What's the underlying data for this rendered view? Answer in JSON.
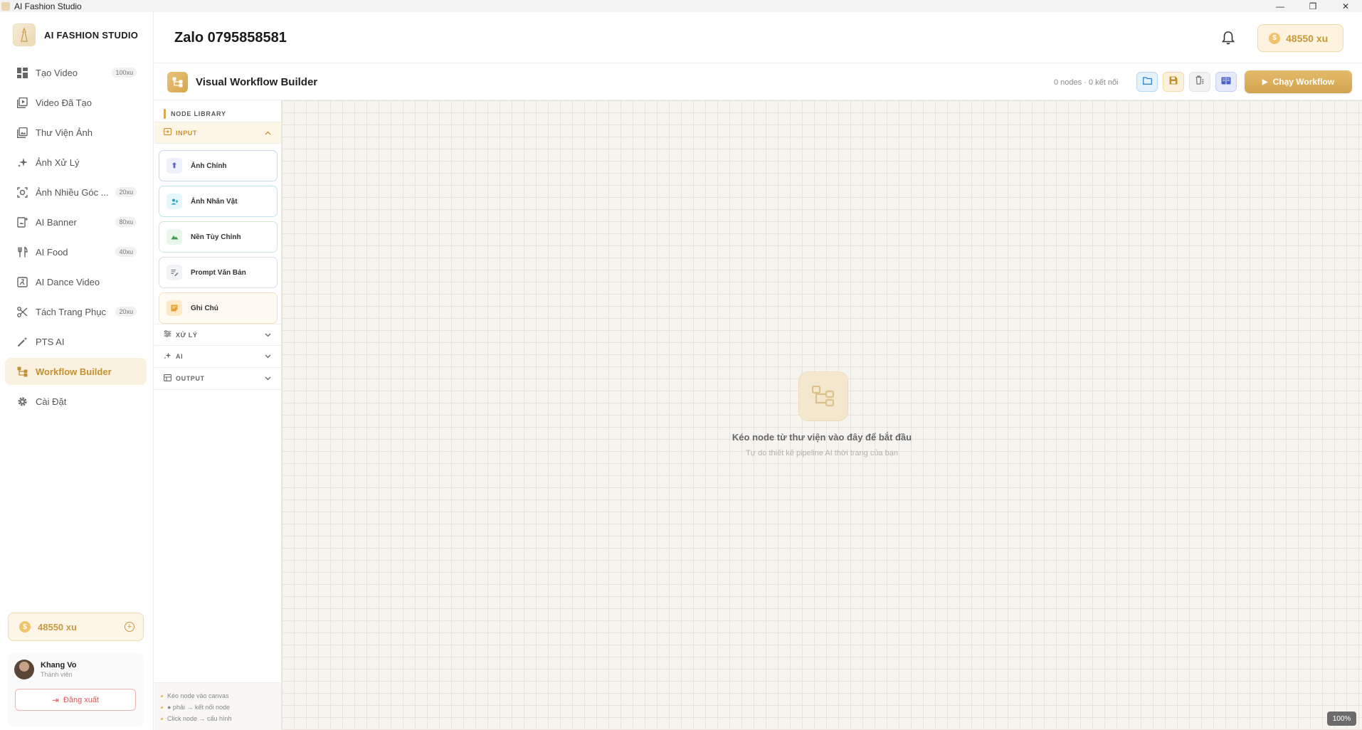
{
  "window": {
    "title": "AI Fashion Studio",
    "controls": [
      "—",
      "❐",
      "✕"
    ]
  },
  "brand": {
    "name": "AI FASHION STUDIO"
  },
  "sidebar": {
    "items": [
      {
        "label": "Tạo Video",
        "badge": "100xu",
        "icon": "grid-icon"
      },
      {
        "label": "Video Đã Tạo",
        "badge": "",
        "icon": "video-library-icon"
      },
      {
        "label": "Thư Viện Ảnh",
        "badge": "",
        "icon": "image-library-icon"
      },
      {
        "label": "Ảnh Xử Lý",
        "badge": "",
        "icon": "sparkle-icon"
      },
      {
        "label": "Ảnh Nhiều Góc ...",
        "badge": "20xu",
        "icon": "camera-icon"
      },
      {
        "label": "AI Banner",
        "badge": "80xu",
        "icon": "banner-icon"
      },
      {
        "label": "AI Food",
        "badge": "40xu",
        "icon": "utensils-icon"
      },
      {
        "label": "AI Dance Video",
        "badge": "",
        "icon": "dance-video-icon"
      },
      {
        "label": "Tách Trang Phục",
        "badge": "20xu",
        "icon": "scissors-icon"
      },
      {
        "label": "PTS AI",
        "badge": "",
        "icon": "magic-wand-icon"
      },
      {
        "label": "Workflow Builder",
        "badge": "",
        "icon": "workflow-icon"
      },
      {
        "label": "Cài Đặt",
        "badge": "",
        "icon": "gear-icon"
      }
    ],
    "active_index": 10,
    "coin_balance": "48550 xu",
    "user": {
      "name": "Khang Vo",
      "role": "Thành viên",
      "logout_label": "Đăng xuất"
    }
  },
  "header": {
    "title": "Zalo 0795858581",
    "coin_balance": "48550 xu"
  },
  "workflow": {
    "title": "Visual Workflow Builder",
    "count": "0 nodes · 0 kết nối",
    "run_label": "Chạy Workflow"
  },
  "library": {
    "heading": "NODE LIBRARY",
    "categories": [
      {
        "label": "INPUT",
        "open": true,
        "icon": "input-icon"
      },
      {
        "label": "XỬ LÝ",
        "open": false,
        "icon": "sliders-icon"
      },
      {
        "label": "AI",
        "open": false,
        "icon": "sparkle-icon"
      },
      {
        "label": "OUTPUT",
        "open": false,
        "icon": "output-icon"
      }
    ],
    "input_nodes": [
      {
        "label": "Ảnh Chính",
        "icon": "upload-icon"
      },
      {
        "label": "Ảnh Nhân Vật",
        "icon": "person-add-icon"
      },
      {
        "label": "Nền Tùy Chỉnh",
        "icon": "landscape-icon"
      },
      {
        "label": "Prompt Văn Bản",
        "icon": "text-edit-icon"
      },
      {
        "label": "Ghi Chú",
        "icon": "note-icon"
      }
    ],
    "tips": [
      "Kéo node vào canvas",
      "● phải → kết nối node",
      "Click node → cấu hình"
    ]
  },
  "canvas": {
    "empty_title": "Kéo node từ thư viện vào đây để bắt đầu",
    "empty_subtitle": "Tự do thiết kế pipeline AI thời trang của bạn",
    "zoom": "100%"
  },
  "colors": {
    "accent": "#d4a44f",
    "active_bg": "#fbf1e0",
    "canvas_bg": "#f6f4ef",
    "danger": "#e25555"
  }
}
